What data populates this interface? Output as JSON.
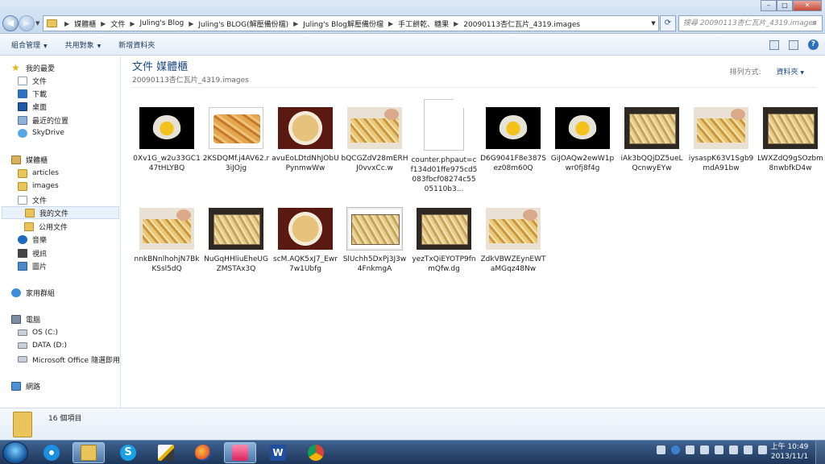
{
  "window": {
    "breadcrumb": [
      "媒體櫃",
      "文件",
      "Juling's Blog",
      "Juling's BLOG(解壓備份檔)",
      "Juling's Blog解壓備份檔",
      "手工餅乾、糖果",
      "20090113杏仁瓦片_4319.images"
    ],
    "search_placeholder": "搜尋 20090113杏仁瓦片_4319.images"
  },
  "toolbar": {
    "organize": "組合管理",
    "share": "共用對象",
    "new_folder": "新增資料夾"
  },
  "sidebar": {
    "favorites_header": "我的最愛",
    "favorites": [
      "文件",
      "下載",
      "桌面",
      "最近的位置",
      "SkyDrive"
    ],
    "libraries_header": "媒體櫃",
    "libraries": [
      "articles",
      "images",
      "文件",
      "我的文件",
      "公用文件",
      "音樂",
      "視訊",
      "圖片"
    ],
    "homegroup": "家用群組",
    "computer_header": "電腦",
    "drives": [
      "OS (C:)",
      "DATA (D:)",
      "Microsoft Office 隨選即用"
    ],
    "network": "網路"
  },
  "content": {
    "library_title": "文件 媒體櫃",
    "folder_name": "20090113杏仁瓦片_4319.images",
    "arrange_label": "排列方式:",
    "arrange_value": "資料夾",
    "items": [
      {
        "name": "0Xv1G_w2u33GC147tHLYBQ",
        "thumb": "yolk"
      },
      {
        "name": "2KSDQMf.j4AV62.r3iJOjg",
        "thumb": "plate"
      },
      {
        "name": "avuEoLDtdNhJObUPynmwWw",
        "thumb": "bowl"
      },
      {
        "name": "bQCGZdV28mERHJ0vvxCc.w",
        "thumb": "hands"
      },
      {
        "name": "counter.phpaut=cf134d01ffe975cd5083fbcf08274c5505110b3...",
        "thumb": "file"
      },
      {
        "name": "D6G9041F8e387Sez08m60Q",
        "thumb": "yolk"
      },
      {
        "name": "GiJOAQw2ewW1pwr0fj8f4g",
        "thumb": "yolk"
      },
      {
        "name": "iAk3bQQjDZ5ueLQcnwyEYw",
        "thumb": "tray"
      },
      {
        "name": "iysaspK63V1Sgb9mdA91bw",
        "thumb": "hands"
      },
      {
        "name": "LWXZdQ9gSOzbm8nwbfkD4w",
        "thumb": "tray"
      },
      {
        "name": "nnkBNnlhohjN7BkKSsl5dQ",
        "thumb": "hands"
      },
      {
        "name": "NuGqHHliuEheUGZMSTAx3Q",
        "thumb": "tray"
      },
      {
        "name": "scM.AQK5xJ7_Ewr7w1Ubfg",
        "thumb": "bowl"
      },
      {
        "name": "SlUchh5DxPj3J3w4FnkmgA",
        "thumb": "framed"
      },
      {
        "name": "yezTxQiEYOTP9fnmQfw.dg",
        "thumb": "tray"
      },
      {
        "name": "ZdkVBWZEynEWTaMGqz48Nw",
        "thumb": "hands"
      }
    ]
  },
  "details": {
    "count": "16 個項目"
  },
  "taskbar": {
    "apps": [
      "ie",
      "explorer",
      "skype",
      "pen",
      "firefox",
      "pink-app",
      "word",
      "chrome"
    ],
    "time": "上午 10:49",
    "date": "2013/11/1"
  }
}
